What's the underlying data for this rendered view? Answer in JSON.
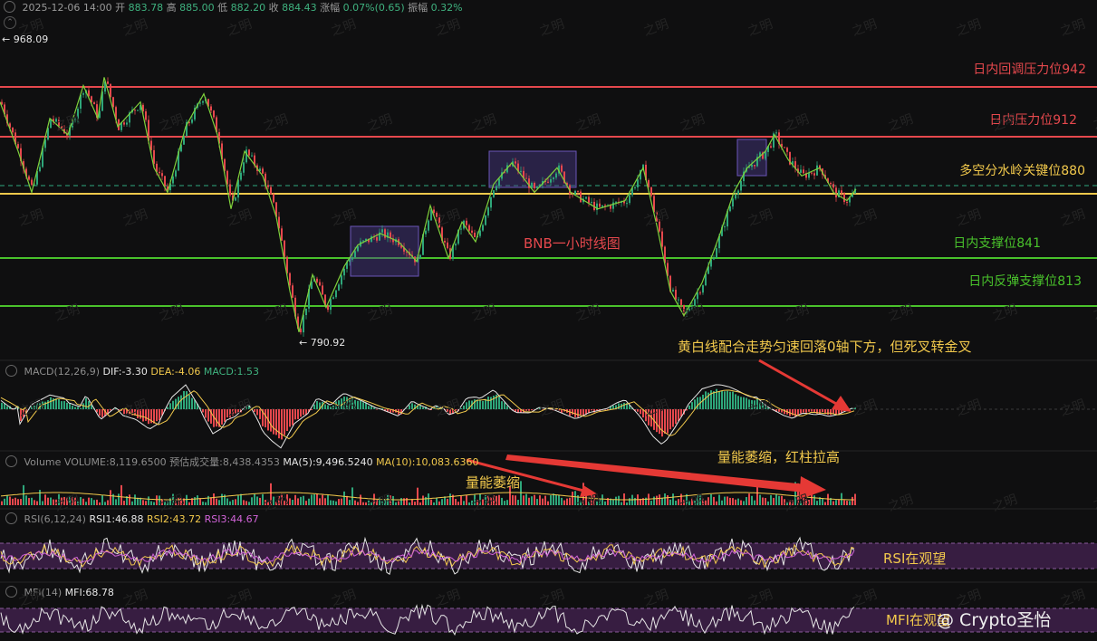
{
  "header": {
    "timestamp": "2025-12-06 14:00",
    "open_label": "开",
    "open": "883.78",
    "high_label": "高",
    "high": "885.00",
    "low_label": "低",
    "low": "882.20",
    "close_label": "收",
    "close": "884.43",
    "change_label": "涨幅",
    "change": "0.07%(0.65)",
    "amplitude_label": "振幅",
    "amplitude": "0.32%"
  },
  "price_markers": {
    "high_marker": "← 968.09",
    "low_marker": "← 790.92"
  },
  "levels": {
    "r2": "日内回调压力位942",
    "r1": "日内压力位912",
    "pivot": "多空分水岭关键位880",
    "s1": "日内支撑位841",
    "s2": "日内反弹支撑位813"
  },
  "annotations": {
    "chart_title": "BNB一小时线图",
    "macd_note": "黄白线配合走势匀速回落0轴下方，但死叉转金叉",
    "vol_note1": "量能萎缩",
    "vol_note2": "量能萎缩，红柱拉高",
    "rsi_note": "RSI在观望",
    "mfi_note": "MFI在观望",
    "watermark_brand": "Crypto圣怡",
    "watermark_tile": "之明"
  },
  "macd": {
    "name": "MACD(12,26,9)",
    "dif": "DIF:-3.30",
    "dea": "DEA:-4.06",
    "macd": "MACD:1.53"
  },
  "volume": {
    "name": "Volume",
    "volume": "VOLUME:8,119.6500",
    "est": "预估成交量:8,438.4353",
    "ma5": "MA(5):9,496.5240",
    "ma10": "MA(10):10,083.6360"
  },
  "rsi": {
    "name": "RSI(6,12,24)",
    "rsi1": "RSI1:46.88",
    "rsi2": "RSI2:43.72",
    "rsi3": "RSI3:44.67"
  },
  "mfi": {
    "name": "MFI(14)",
    "mfi": "MFI:68.78"
  },
  "colors": {
    "bg": "#0f0f10",
    "up": "#2ea67a",
    "down": "#e5484d",
    "resistance": "#e5484d",
    "pivot": "#f2c94c",
    "support": "#49c22b",
    "box": "#6a55b8"
  },
  "chart_data": {
    "type": "candlestick",
    "title": "BNB一小时线图",
    "ylim": [
      785,
      975
    ],
    "y_high": 968.09,
    "y_low": 790.92,
    "last_close": 884.43,
    "horizontal_levels": [
      942,
      912,
      880,
      841,
      813
    ],
    "series_path": [
      [
        0,
        935
      ],
      [
        20,
        905
      ],
      [
        35,
        880
      ],
      [
        55,
        925
      ],
      [
        75,
        915
      ],
      [
        92,
        945
      ],
      [
        108,
        925
      ],
      [
        115,
        950
      ],
      [
        130,
        920
      ],
      [
        155,
        935
      ],
      [
        170,
        895
      ],
      [
        185,
        880
      ],
      [
        205,
        920
      ],
      [
        225,
        940
      ],
      [
        240,
        915
      ],
      [
        255,
        870
      ],
      [
        270,
        905
      ],
      [
        290,
        890
      ],
      [
        305,
        865
      ],
      [
        320,
        820
      ],
      [
        330,
        795
      ],
      [
        345,
        830
      ],
      [
        360,
        810
      ],
      [
        380,
        835
      ],
      [
        395,
        848
      ],
      [
        420,
        855
      ],
      [
        440,
        850
      ],
      [
        460,
        838
      ],
      [
        475,
        872
      ],
      [
        495,
        840
      ],
      [
        510,
        862
      ],
      [
        525,
        850
      ],
      [
        545,
        885
      ],
      [
        565,
        898
      ],
      [
        590,
        880
      ],
      [
        615,
        895
      ],
      [
        630,
        880
      ],
      [
        660,
        870
      ],
      [
        690,
        875
      ],
      [
        710,
        895
      ],
      [
        725,
        860
      ],
      [
        740,
        820
      ],
      [
        755,
        805
      ],
      [
        775,
        825
      ],
      [
        795,
        855
      ],
      [
        810,
        880
      ],
      [
        825,
        895
      ],
      [
        845,
        905
      ],
      [
        855,
        915
      ],
      [
        870,
        900
      ],
      [
        885,
        890
      ],
      [
        905,
        895
      ],
      [
        920,
        880
      ],
      [
        935,
        875
      ],
      [
        945,
        882
      ]
    ]
  }
}
